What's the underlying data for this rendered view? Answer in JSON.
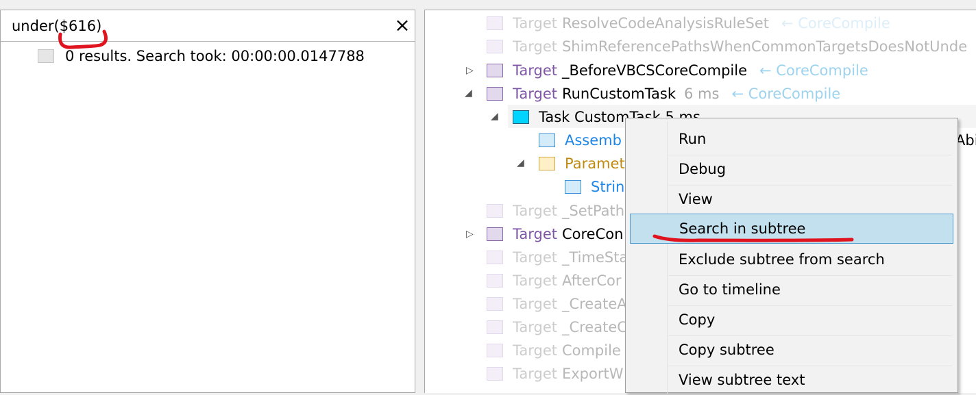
{
  "search": {
    "query": "under($616)",
    "clear_icon": "×",
    "result_text": "0 results. Search took: 00:00:00.0147788"
  },
  "tree": {
    "rows": [
      {
        "kind": "target",
        "faded": true,
        "keyword": "Target",
        "name": "ResolveCodeAnalysisRuleSet",
        "parent": "← CoreCompile"
      },
      {
        "kind": "target",
        "faded": true,
        "keyword": "Target",
        "name": "ShimReferencePathsWhenCommonTargetsDoesNotUnde"
      },
      {
        "kind": "target",
        "faded": false,
        "keyword": "Target",
        "name": "_BeforeVBCSCoreCompile",
        "parent": "← CoreCompile",
        "expander": "▷"
      },
      {
        "kind": "target",
        "faded": false,
        "keyword": "Target",
        "name": "RunCustomTask",
        "duration": "6 ms",
        "parent": "← CoreCompile",
        "expander": "◢"
      },
      {
        "kind": "task",
        "label": "Task CustomTask  5 ms",
        "expander": "◢"
      },
      {
        "kind": "assembly",
        "label": "Assemb",
        "tail": "Abi"
      },
      {
        "kind": "parameter",
        "label": "Paramet",
        "expander": "◢"
      },
      {
        "kind": "string",
        "label": "Strin"
      },
      {
        "kind": "target",
        "faded": true,
        "keyword": "Target",
        "name": "_SetPath"
      },
      {
        "kind": "target",
        "faded": false,
        "keyword": "Target",
        "name": "CoreCon",
        "expander": "▷"
      },
      {
        "kind": "target",
        "faded": true,
        "keyword": "Target",
        "name": "_TimeSta"
      },
      {
        "kind": "target",
        "faded": true,
        "keyword": "Target",
        "name": "AfterCor"
      },
      {
        "kind": "target",
        "faded": true,
        "keyword": "Target",
        "name": "_CreateA"
      },
      {
        "kind": "target",
        "faded": true,
        "keyword": "Target",
        "name": "_CreateC"
      },
      {
        "kind": "target",
        "faded": true,
        "keyword": "Target",
        "name": "Compile"
      },
      {
        "kind": "target",
        "faded": true,
        "keyword": "Target",
        "name": "ExportW"
      }
    ]
  },
  "context_menu": {
    "items": [
      {
        "label": "Run"
      },
      {
        "label": "Debug"
      },
      {
        "label": "View"
      },
      {
        "label": "Search in subtree",
        "highlighted": true
      },
      {
        "label": "Exclude subtree from search"
      },
      {
        "label": "Go to timeline"
      },
      {
        "label": "Copy"
      },
      {
        "label": "Copy subtree"
      },
      {
        "label": "View subtree text"
      }
    ]
  },
  "colors": {
    "annotation_red": "#e0141e",
    "target_purple": "#7f56a6",
    "menu_highlight": "#c2e0ee",
    "task_cyan": "#00d4ff"
  }
}
